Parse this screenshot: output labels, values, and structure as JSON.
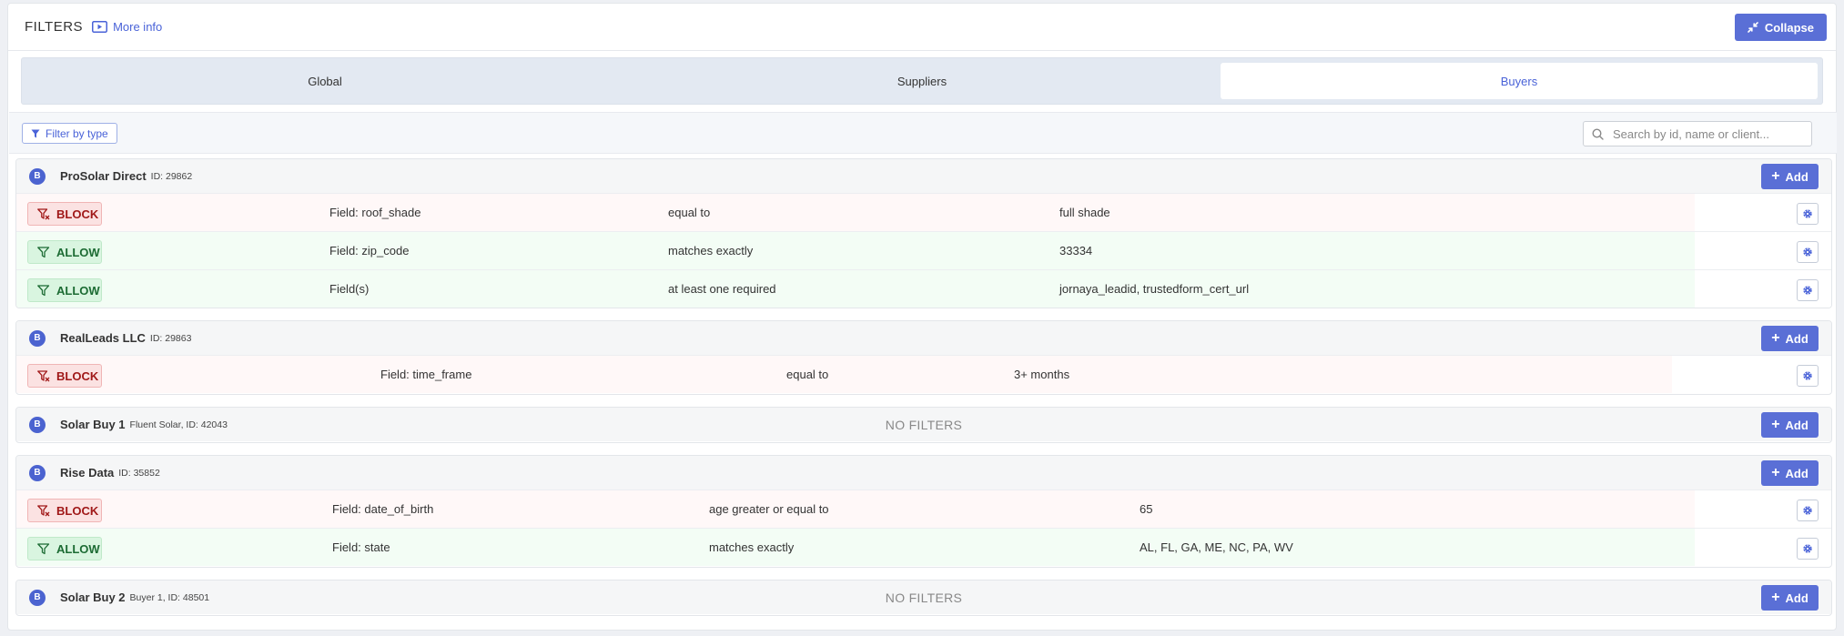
{
  "header": {
    "title": "FILTERS",
    "more_info": "More info",
    "collapse_label": "Collapse"
  },
  "tabs": [
    {
      "label": "Global",
      "active": false
    },
    {
      "label": "Suppliers",
      "active": false
    },
    {
      "label": "Buyers",
      "active": true
    }
  ],
  "toolbar": {
    "filter_by_type": "Filter by type",
    "search_placeholder": "Search by id, name or client..."
  },
  "colors": {
    "accent": "#5a6fd6",
    "block_red": "#a01818",
    "allow_green": "#1c6b33"
  },
  "add_label": "Add",
  "buyers": [
    {
      "badge": "B",
      "name": "ProSolar Direct",
      "id_text": "ID: 29862",
      "rules": [
        {
          "type": "BLOCK",
          "field": "Field: roof_shade",
          "operator": "equal to",
          "value": "full shade"
        },
        {
          "type": "ALLOW",
          "field": "Field: zip_code",
          "operator": "matches exactly",
          "value": "33334"
        },
        {
          "type": "ALLOW",
          "field": "Field(s)",
          "operator": "at least one required",
          "value": "jornaya_leadid, trustedform_cert_url"
        }
      ]
    },
    {
      "badge": "B",
      "name": "RealLeads LLC",
      "id_text": "ID: 29863",
      "rules": [
        {
          "type": "BLOCK",
          "field": "Field: time_frame",
          "operator": "equal to",
          "value": "3+ months"
        }
      ]
    },
    {
      "badge": "B",
      "name": "Solar Buy 1",
      "id_text": "Fluent Solar, ID: 42043",
      "no_filters": "NO FILTERS"
    },
    {
      "badge": "B",
      "name": "Rise Data",
      "id_text": "ID: 35852",
      "rules": [
        {
          "type": "BLOCK",
          "field": "Field: date_of_birth",
          "operator": "age greater or equal to",
          "value": "65"
        },
        {
          "type": "ALLOW",
          "field": "Field: state",
          "operator": "matches exactly",
          "value": "AL, FL, GA, ME, NC, PA, WV"
        }
      ]
    },
    {
      "badge": "B",
      "name": "Solar Buy 2",
      "id_text": "Buyer 1, ID: 48501",
      "no_filters": "NO FILTERS"
    }
  ]
}
